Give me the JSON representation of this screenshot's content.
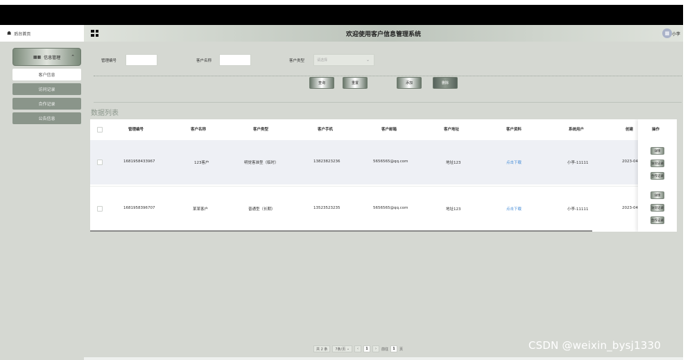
{
  "sidebar": {
    "home": "后台首页",
    "menu_head": "信息管理",
    "items": [
      {
        "label": "客户信息",
        "active": true
      },
      {
        "label": "访问记录",
        "active": false
      },
      {
        "label": "合作记录",
        "active": false
      },
      {
        "label": "公告信息",
        "active": false
      }
    ]
  },
  "header": {
    "title": "欢迎使用客户信息管理系统",
    "username": "小李"
  },
  "search": {
    "label_code": "管理编号",
    "label_name": "客户名称",
    "label_type": "客户类型",
    "type_placeholder": "请选择",
    "btn_query": "查询",
    "btn_reset": "重置",
    "btn_add": "添加",
    "btn_delete": "删除"
  },
  "list_title": "数据列表",
  "table": {
    "headers": [
      "管理编号",
      "客户名称",
      "客户类型",
      "客户手机",
      "客户邮箱",
      "客户地址",
      "客户资料",
      "系统用户",
      "创建",
      "操作"
    ],
    "rows": [
      {
        "code": "1681958433967",
        "name": "123客户",
        "type": "明觉客准型（临时）",
        "phone": "13823823236",
        "email": "5656565@qq.com",
        "address": "地址123",
        "file": "点击下载",
        "user": "小李-11111",
        "created": "2023-04-"
      },
      {
        "code": "1681958396707",
        "name": "某某客户",
        "type": "普通型（长期）",
        "phone": "13523523235",
        "email": "5656565@qq.com",
        "address": "地址123",
        "file": "点击下载",
        "user": "小李-11111",
        "created": "2023-04-"
      }
    ],
    "op_labels": [
      "详情",
      "访问记录",
      "合作记录"
    ]
  },
  "pager": {
    "total": "共 2 条",
    "page_size": "7条/页",
    "current": "1",
    "goto_label": "前往",
    "goto_value": "1",
    "page_suffix": "页"
  },
  "watermark": "CSDN @weixin_bysj1330"
}
